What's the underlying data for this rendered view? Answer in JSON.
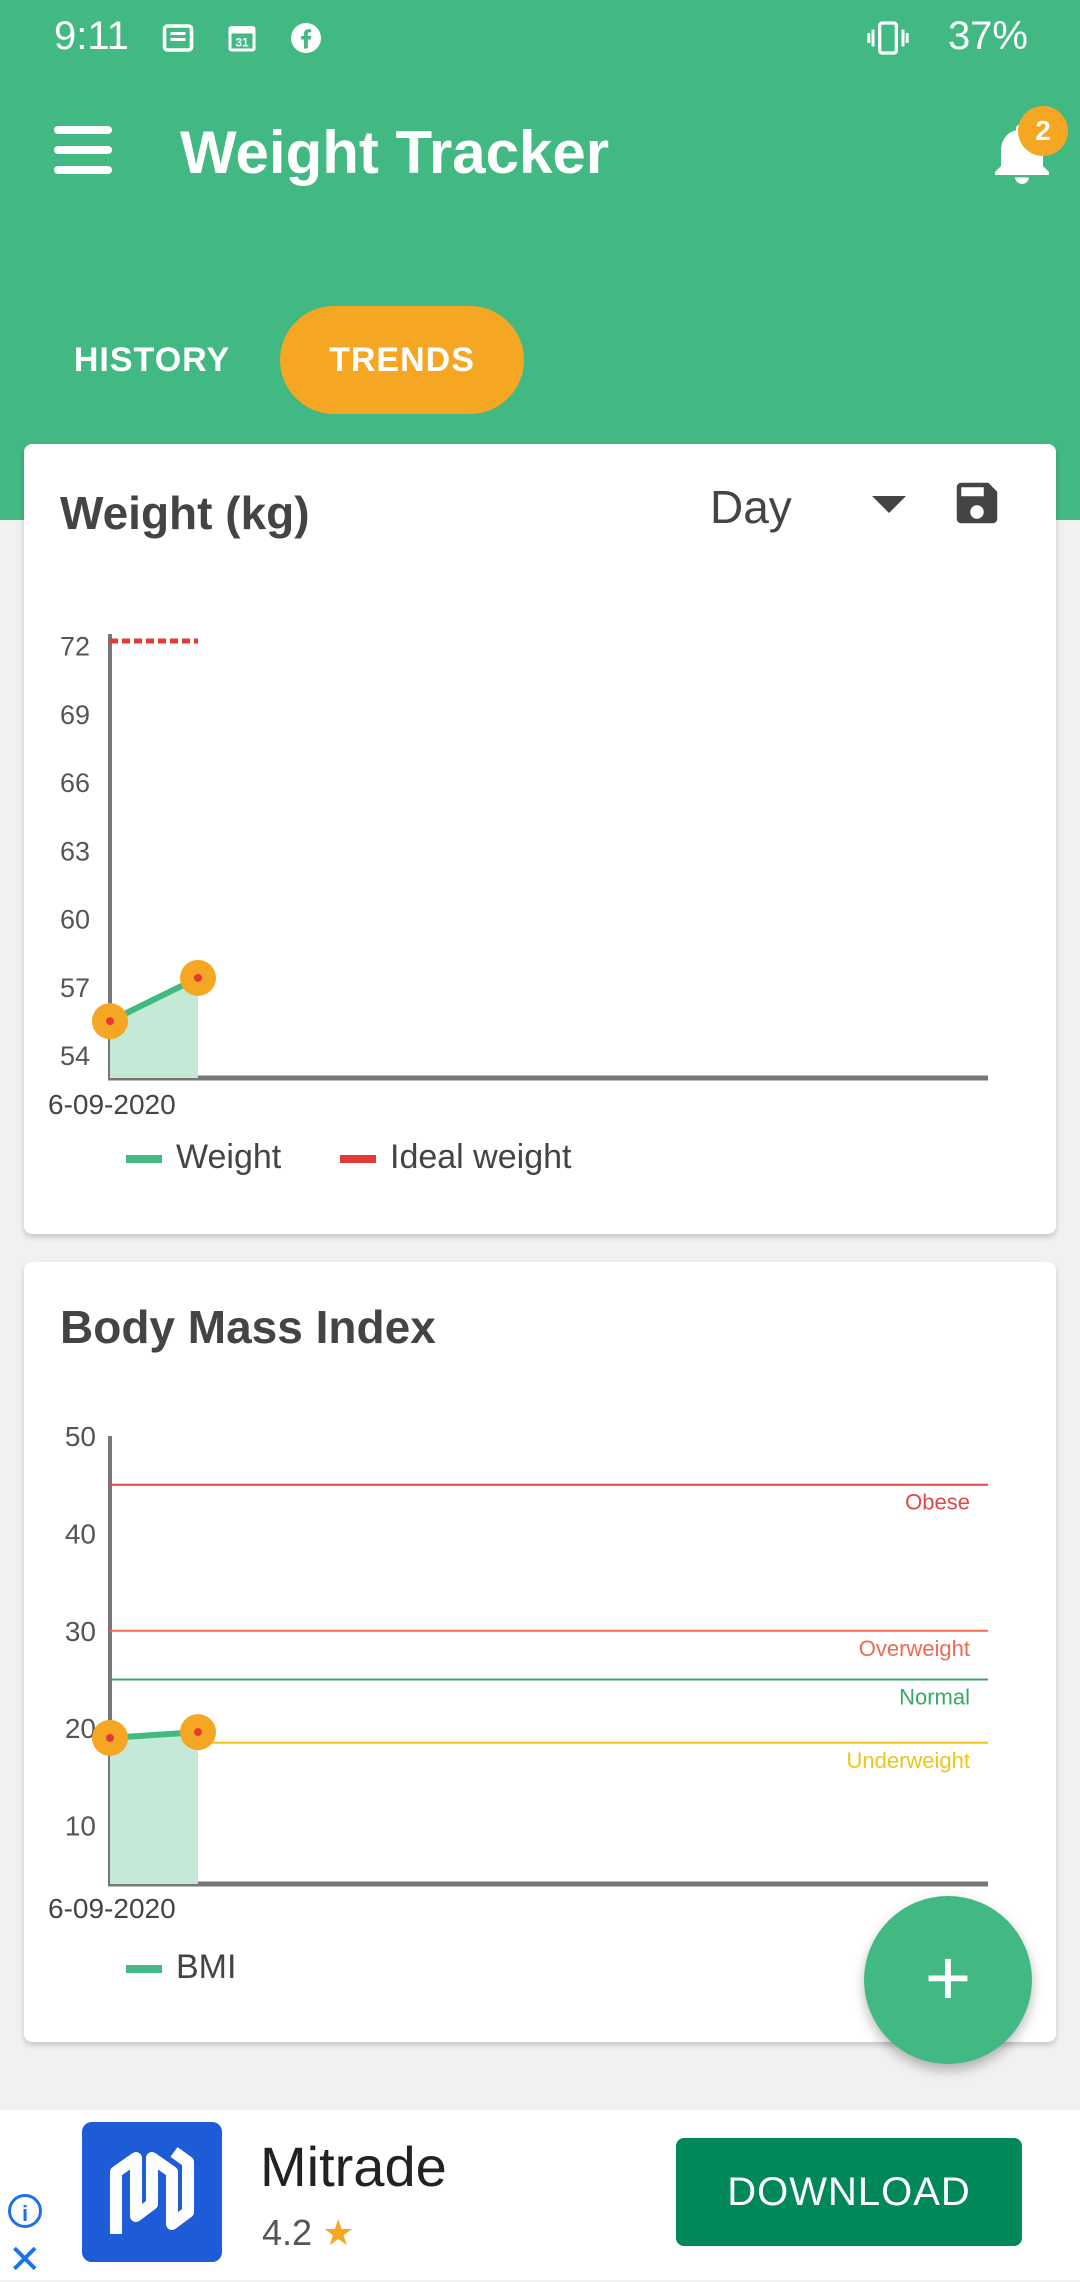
{
  "status_bar": {
    "time": "9:11",
    "battery": "37%"
  },
  "app_bar": {
    "title": "Weight Tracker",
    "notification_count": "2"
  },
  "tabs": [
    {
      "label": "HISTORY",
      "active": false
    },
    {
      "label": "TRENDS",
      "active": true
    }
  ],
  "weight_card": {
    "title": "Weight (kg)",
    "period": "Day",
    "legend": [
      {
        "label": "Weight",
        "color": "#42b883"
      },
      {
        "label": "Ideal weight",
        "color": "#e53935"
      }
    ],
    "x_label": "6-09-2020"
  },
  "bmi_card": {
    "title": "Body Mass Index",
    "legend": [
      {
        "label": "BMI",
        "color": "#42b883"
      }
    ],
    "x_label": "6-09-2020",
    "zones": [
      {
        "label": "Obese",
        "value": 45,
        "color": "#e04848"
      },
      {
        "label": "Overweight",
        "value": 30,
        "color": "#ee6a52"
      },
      {
        "label": "Normal",
        "value": 25,
        "color": "#3aa863"
      },
      {
        "label": "Underweight",
        "value": 18.5,
        "color": "#f0c419"
      }
    ]
  },
  "chart_data": [
    {
      "type": "area",
      "title": "Weight (kg)",
      "x": [
        "6-09-2020",
        ""
      ],
      "series": [
        {
          "name": "Weight",
          "values": [
            55.5,
            57.4
          ],
          "color": "#42b883"
        },
        {
          "name": "Ideal weight",
          "values": [
            72.2,
            72.2
          ],
          "color": "#e53935"
        }
      ],
      "yticks": [
        54,
        57,
        60,
        63,
        66,
        69,
        72
      ],
      "ylim": [
        53,
        74
      ],
      "legend_position": "bottom-left"
    },
    {
      "type": "area",
      "title": "Body Mass Index",
      "x": [
        "6-09-2020",
        ""
      ],
      "series": [
        {
          "name": "BMI",
          "values": [
            19.0,
            19.6
          ],
          "color": "#42b883"
        }
      ],
      "yticks": [
        10,
        20,
        30,
        40,
        50
      ],
      "ylim": [
        4,
        50
      ],
      "legend_position": "bottom-left"
    }
  ],
  "fab": {
    "label": "+"
  },
  "ad": {
    "name": "Mitrade",
    "rating": "4.2",
    "cta": "DOWNLOAD",
    "close": "✕",
    "info": "i"
  }
}
